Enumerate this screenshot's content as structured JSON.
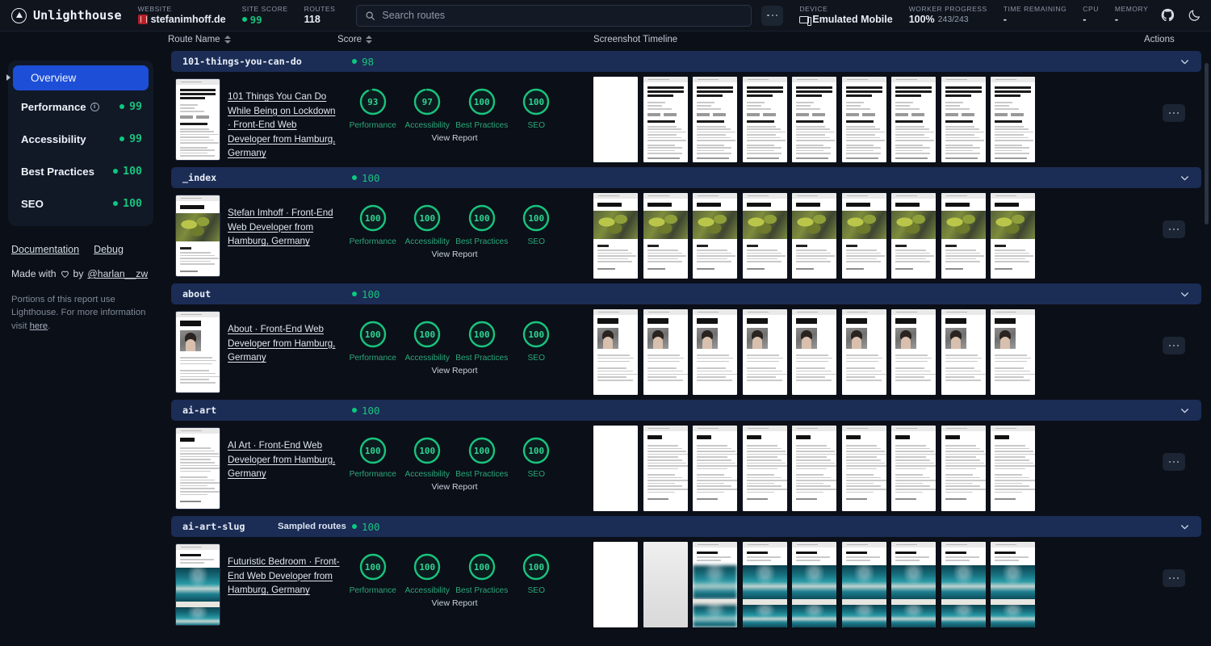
{
  "header": {
    "brand": "Unlighthouse",
    "website_label": "WEBSITE",
    "website_value": "stefanimhoff.de",
    "site_score_label": "SITE SCORE",
    "site_score_value": "99",
    "routes_label": "ROUTES",
    "routes_value": "118",
    "search_placeholder": "Search routes",
    "search_value": "",
    "device_label": "DEVICE",
    "device_value": "Emulated Mobile",
    "worker_label": "WORKER PROGRESS",
    "worker_value": "100%",
    "worker_sub": "243/243",
    "time_label": "TIME REMAINING",
    "time_value": "-",
    "cpu_label": "CPU",
    "cpu_value": "-",
    "memory_label": "MEMORY",
    "memory_value": "-"
  },
  "columns": {
    "route_name": "Route Name",
    "score": "Score",
    "screenshot_timeline": "Screenshot Timeline",
    "actions": "Actions"
  },
  "sidebar": {
    "overview": "Overview",
    "categories": [
      {
        "label": "Performance",
        "score": "99",
        "has_info": true
      },
      {
        "label": "Accessibility",
        "score": "99",
        "has_info": false
      },
      {
        "label": "Best Practices",
        "score": "100",
        "has_info": false
      },
      {
        "label": "SEO",
        "score": "100",
        "has_info": false
      }
    ],
    "links": [
      "Documentation",
      "Debug"
    ],
    "made_with_prefix": "Made with",
    "made_with_suffix": "by",
    "made_with_author": "@harlan__zw",
    "portions_text": "Portions of this report use Lighthouse. For more information visit ",
    "portions_link": "here",
    "portions_end": "."
  },
  "colors": {
    "accent_blue": "#1d4ed8",
    "group_bar": "#1b2c55",
    "green": "#19c37d",
    "bg": "#0b0f17",
    "panel": "#111927"
  },
  "rows": [
    {
      "group": "101-things-you-can-do",
      "sampled": "",
      "group_score": "98",
      "title": "101 Things You Can Do While Being on Lockdown · Front-End Web Developer from Hamburg, Germany",
      "scores": [
        {
          "label": "Performance",
          "value": "93"
        },
        {
          "label": "Accessibility",
          "value": "97"
        },
        {
          "label": "Best Practices",
          "value": "100"
        },
        {
          "label": "SEO",
          "value": "100"
        }
      ],
      "view_report": "View Report",
      "thumb_kind": "article",
      "thumb_heading": "101 Things You Can Do While Being on Lockdown",
      "frames": [
        0,
        1,
        1,
        1,
        1,
        1,
        1,
        1,
        1
      ]
    },
    {
      "group": "_index",
      "sampled": "",
      "group_score": "100",
      "title": "Stefan Imhoff · Front-End Web Developer from Hamburg, Germany",
      "scores": [
        {
          "label": "Performance",
          "value": "100"
        },
        {
          "label": "Accessibility",
          "value": "100"
        },
        {
          "label": "Best Practices",
          "value": "100"
        },
        {
          "label": "SEO",
          "value": "100"
        }
      ],
      "view_report": "View Report",
      "thumb_kind": "leaf",
      "thumb_heading": "Stefan Imhoff",
      "frames": [
        1,
        1,
        1,
        1,
        1,
        1,
        1,
        1,
        1
      ]
    },
    {
      "group": "about",
      "sampled": "",
      "group_score": "100",
      "title": "About · Front-End Web Developer from Hamburg, Germany",
      "scores": [
        {
          "label": "Performance",
          "value": "100"
        },
        {
          "label": "Accessibility",
          "value": "100"
        },
        {
          "label": "Best Practices",
          "value": "100"
        },
        {
          "label": "SEO",
          "value": "100"
        }
      ],
      "view_report": "View Report",
      "thumb_kind": "about",
      "thumb_heading": "About",
      "frames": [
        1,
        1,
        1,
        1,
        1,
        1,
        1,
        1,
        1
      ]
    },
    {
      "group": "ai-art",
      "sampled": "",
      "group_score": "100",
      "title": "AI Art · Front-End Web Developer from Hamburg, Germany",
      "scores": [
        {
          "label": "Performance",
          "value": "100"
        },
        {
          "label": "Accessibility",
          "value": "100"
        },
        {
          "label": "Best Practices",
          "value": "100"
        },
        {
          "label": "SEO",
          "value": "100"
        }
      ],
      "view_report": "View Report",
      "thumb_kind": "text",
      "thumb_heading": "AI Art",
      "frames": [
        0,
        1,
        1,
        1,
        1,
        1,
        1,
        1,
        1
      ]
    },
    {
      "group": "ai-art-slug",
      "sampled": "Sampled routes",
      "group_score": "100",
      "title": "Futuristic Bedroom · Front-End Web Developer from Hamburg, Germany",
      "scores": [
        {
          "label": "Performance",
          "value": "100"
        },
        {
          "label": "Accessibility",
          "value": "100"
        },
        {
          "label": "Best Practices",
          "value": "100"
        },
        {
          "label": "SEO",
          "value": "100"
        }
      ],
      "view_report": "View Report",
      "thumb_kind": "bedroom",
      "thumb_heading": "Futuristic Bedroom",
      "frames": [
        0,
        2,
        3,
        1,
        1,
        1,
        1,
        1,
        1
      ]
    }
  ]
}
